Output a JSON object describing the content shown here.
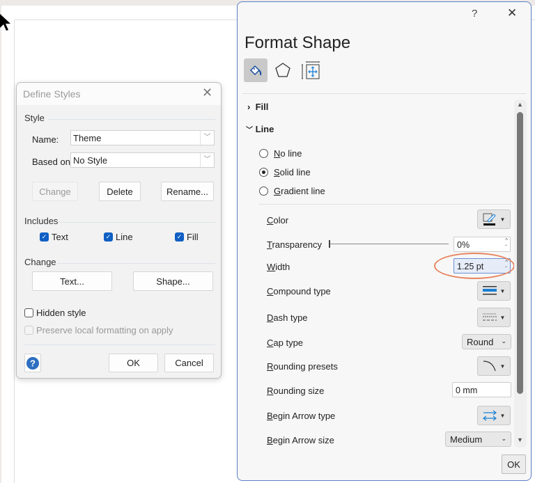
{
  "define_styles": {
    "title": "Define Styles",
    "style_section": "Style",
    "name_label": "Name:",
    "name_value": "Theme",
    "based_on_label": "Based on:",
    "based_on_value": "No Style",
    "buttons": {
      "change": "Change",
      "delete": "Delete",
      "rename": "Rename..."
    },
    "includes_section": "Includes",
    "includes": [
      {
        "label": "Text",
        "checked": true
      },
      {
        "label": "Line",
        "checked": true
      },
      {
        "label": "Fill",
        "checked": true
      }
    ],
    "change_section": "Change",
    "change_buttons": {
      "text": "Text...",
      "shape": "Shape..."
    },
    "hidden_style": {
      "label": "Hidden style",
      "checked": false
    },
    "preserve": {
      "label": "Preserve local formatting on apply",
      "checked": false,
      "disabled": true
    },
    "ok": "OK",
    "cancel": "Cancel"
  },
  "format_shape": {
    "help": "?",
    "title": "Format Shape",
    "tabs": [
      "fill-line-icon",
      "effects-pentagon-icon",
      "size-properties-icon"
    ],
    "fill_section": "Fill",
    "line_section": "Line",
    "line_options": [
      {
        "label": "No line",
        "selected": false
      },
      {
        "label": "Solid line",
        "selected": true
      },
      {
        "label": "Gradient line",
        "selected": false
      }
    ],
    "props": {
      "color": "Color",
      "transparency": "Transparency",
      "transparency_value": "0%",
      "transparency_percent": 0,
      "width": "Width",
      "width_value": "1.25 pt",
      "compound": "Compound type",
      "dash": "Dash type",
      "cap": "Cap type",
      "cap_value": "Round",
      "rounding_presets": "Rounding presets",
      "rounding_size": "Rounding size",
      "rounding_size_value": "0 mm",
      "begin_arrow_type": "Begin Arrow type",
      "begin_arrow_size": "Begin Arrow size",
      "begin_arrow_size_value": "Medium"
    },
    "ok": "OK",
    "highlight_color": "#e8845e",
    "accent": "#1a7fd4"
  }
}
